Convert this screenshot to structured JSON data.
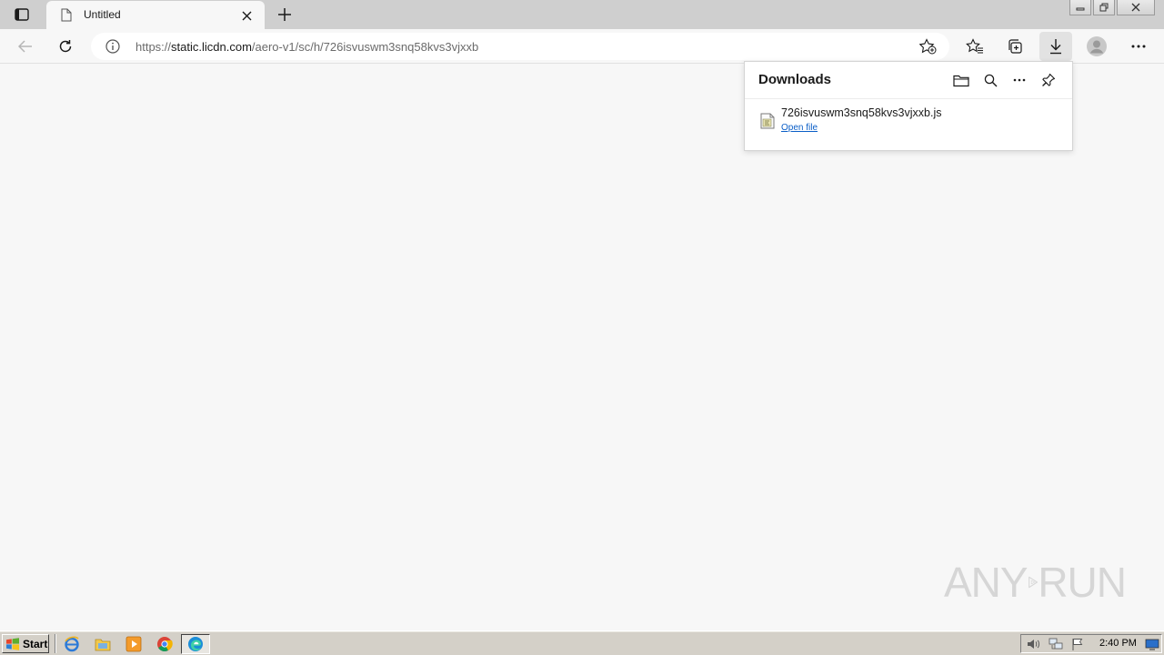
{
  "browser": {
    "tab": {
      "title": "Untitled"
    },
    "address": {
      "url_prefix": "https://",
      "url_host": "static.licdn.com",
      "url_path": "/aero-v1/sc/h/726isvuswm3snq58kvs3vjxxb"
    }
  },
  "downloads": {
    "title": "Downloads",
    "items": [
      {
        "file_name": "726isvuswm3snq58kvs3vjxxb.js",
        "action_label": "Open file"
      }
    ]
  },
  "watermark": {
    "text_left": "ANY",
    "text_right": "RUN"
  },
  "taskbar": {
    "start_label": "Start",
    "clock": "2:40 PM"
  },
  "colors": {
    "accent_link": "#0a5ec7",
    "tabstrip": "#cfcfcf",
    "page_bg": "#f7f7f7",
    "taskbar": "#d4d0c8"
  }
}
